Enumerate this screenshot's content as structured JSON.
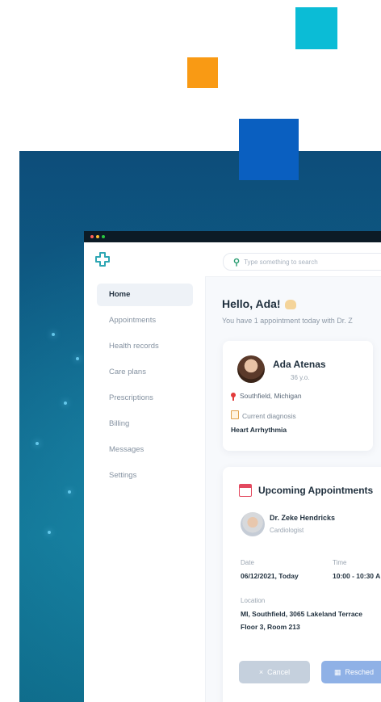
{
  "colors": {
    "accent_teal": "#0bbcd6",
    "accent_orange": "#f99a14",
    "accent_blue": "#0a5fc0",
    "primary": "#8fb1e6"
  },
  "app": {
    "search_placeholder": "Type something to search",
    "logo_icon": "medical-cross-logo"
  },
  "sidebar": {
    "items": [
      {
        "label": "Home",
        "active": true
      },
      {
        "label": "Appointments"
      },
      {
        "label": "Health records"
      },
      {
        "label": "Care plans"
      },
      {
        "label": "Prescriptions"
      },
      {
        "label": "Billing"
      },
      {
        "label": "Messages"
      },
      {
        "label": "Settings"
      }
    ]
  },
  "main": {
    "greeting": "Hello, Ada!",
    "subtitle": "You have 1 appointment today with Dr. Z",
    "profile": {
      "name": "Ada Atenas",
      "age": "36 y.o.",
      "location": "Southfield, Michigan",
      "diagnosis_label": "Current diagnosis",
      "diagnosis": "Heart Arrhythmia"
    },
    "appointments": {
      "title": "Upcoming Appointments",
      "doctor_name": "Dr. Zeke Hendricks",
      "doctor_specialty": "Cardiologist",
      "date_label": "Date",
      "date_value": "06/12/2021, Today",
      "time_label": "Time",
      "time_value": "10:00 - 10:30 A",
      "location_label": "Location",
      "location_line1": "MI, Southfield, 3065 Lakeland Terrace",
      "location_line2": "Floor 3, Room 213",
      "cancel_label": "Cancel",
      "reschedule_label": "Resched"
    }
  }
}
